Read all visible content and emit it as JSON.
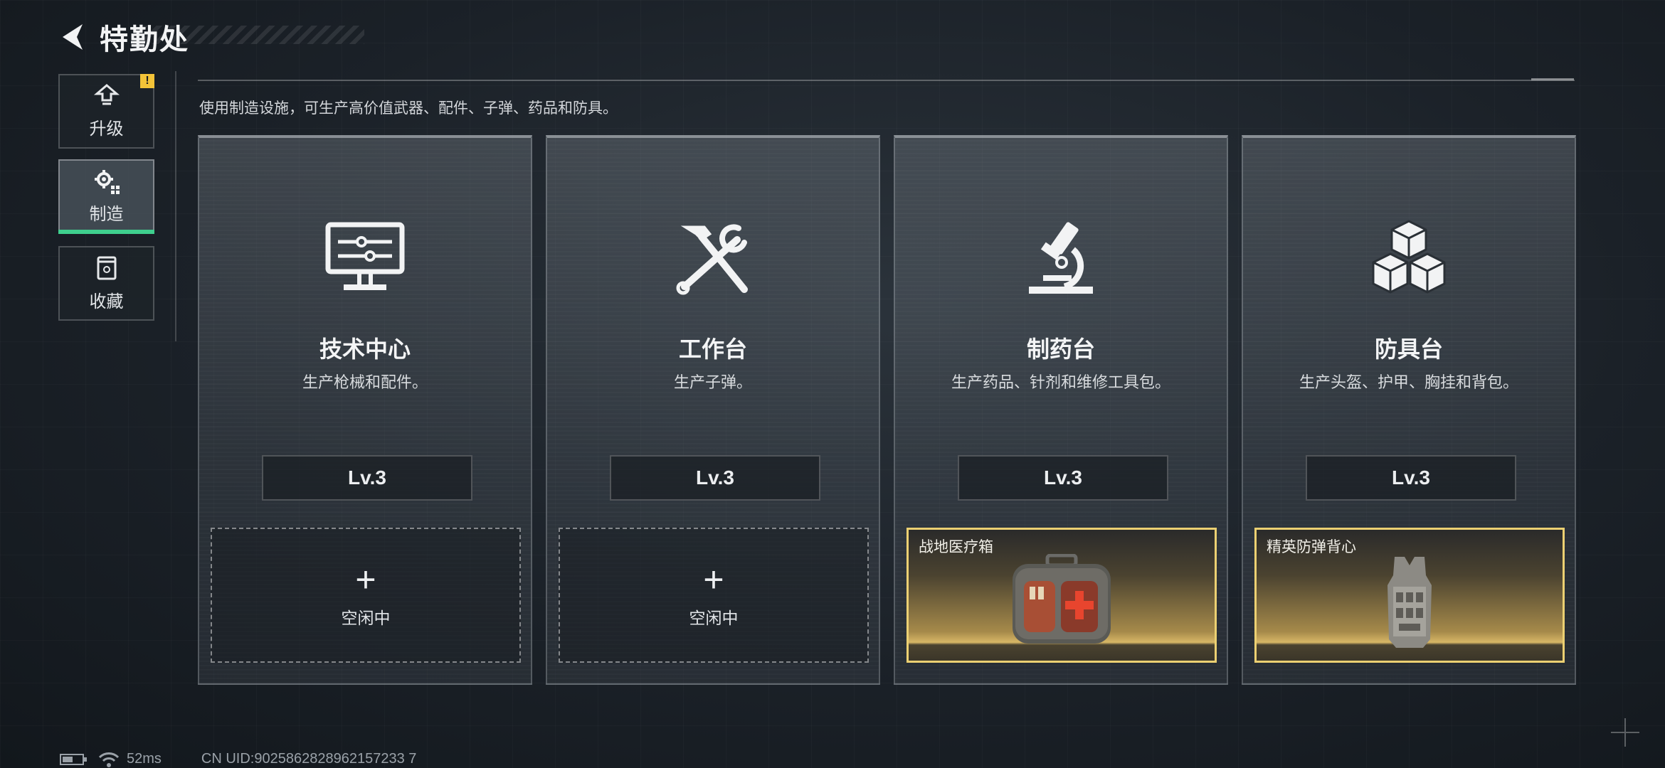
{
  "header": {
    "title": "特勤处"
  },
  "nav": {
    "items": [
      {
        "label": "升级",
        "alert": "!"
      },
      {
        "label": "制造"
      },
      {
        "label": "收藏"
      }
    ]
  },
  "description": "使用制造设施，可生产高价值武器、配件、子弹、药品和防具。",
  "cards": [
    {
      "title": "技术中心",
      "desc": "生产枪械和配件。",
      "level": "Lv.3",
      "slot": {
        "state": "empty",
        "label": "空闲中"
      }
    },
    {
      "title": "工作台",
      "desc": "生产子弹。",
      "level": "Lv.3",
      "slot": {
        "state": "empty",
        "label": "空闲中"
      }
    },
    {
      "title": "制药台",
      "desc": "生产药品、针剂和维修工具包。",
      "level": "Lv.3",
      "slot": {
        "state": "filled",
        "item_name": "战地医疗箱"
      }
    },
    {
      "title": "防具台",
      "desc": "生产头盔、护甲、胸挂和背包。",
      "level": "Lv.3",
      "slot": {
        "state": "filled",
        "item_name": "精英防弹背心"
      }
    }
  ],
  "status_bar": {
    "ping": "52ms",
    "uid": "CN UID:9025862828962157233 7"
  },
  "colors": {
    "accent_green": "#3fcf8e",
    "alert_yellow": "#f3c338",
    "slot_gold": "#ecd072"
  }
}
